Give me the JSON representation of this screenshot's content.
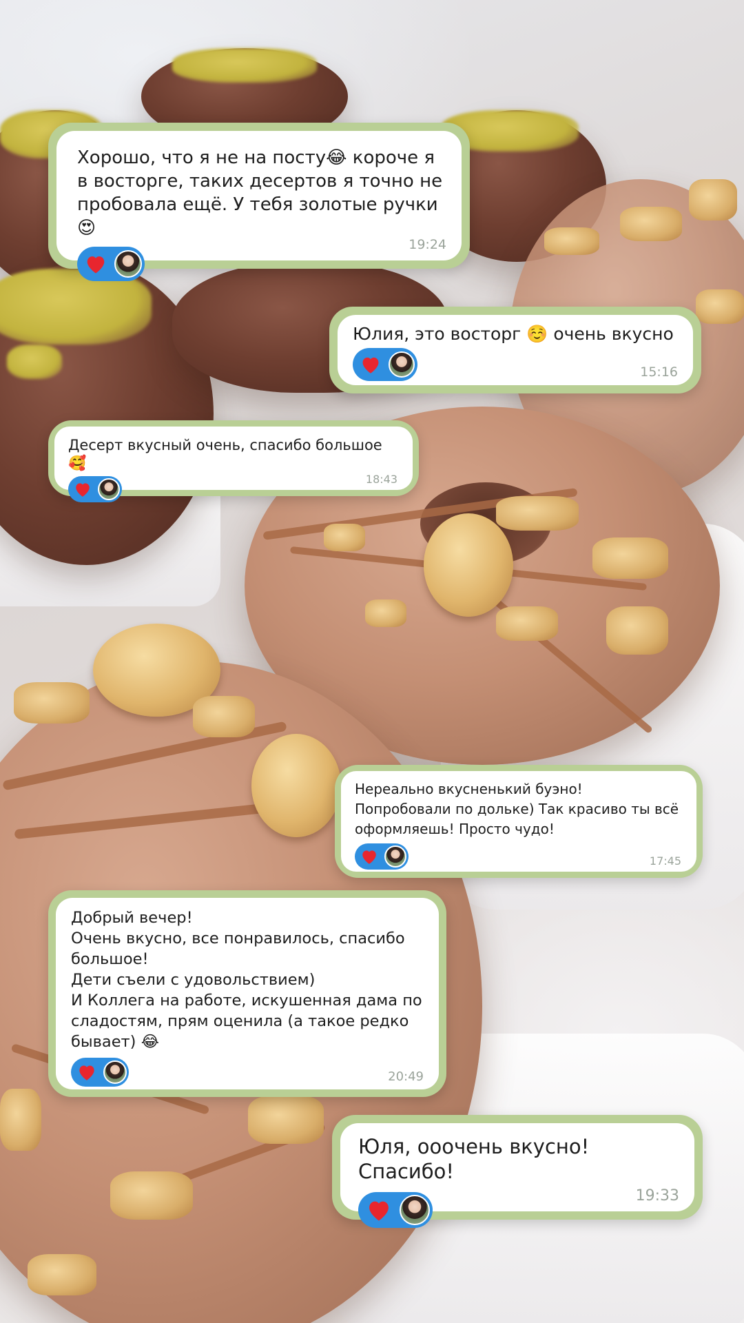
{
  "colors": {
    "bubble_frame": "#b9cf95",
    "bubble_fill": "#ffffff",
    "reaction_pill": "#2f8fe0",
    "heart": "#e8262e",
    "time_text": "#9aa39a",
    "message_text": "#1d1d1d"
  },
  "messages": [
    {
      "text": "Хорошо, что я не на посту😂 короче я\nв восторге, таких десертов я точно не\nпробовала ещё. У тебя золотые ручки😍",
      "time": "19:24",
      "reaction": "heart-icon"
    },
    {
      "text": "Юлия, это восторг ☺️ очень вкусно",
      "time": "15:16",
      "reaction": "heart-icon"
    },
    {
      "text": "Десерт вкусный очень, спасибо большое 🥰",
      "time": "18:43",
      "reaction": "heart-icon"
    },
    {
      "text": "Нереально вкусненький буэно!\nПопробовали по дольке) Так красиво ты всё\nоформляешь! Просто чудо!",
      "time": "17:45",
      "reaction": "heart-icon"
    },
    {
      "text": "Добрый вечер!\nОчень вкусно, все понравилось, спасибо\nбольшое!\nДети съели с удовольствием)\nИ Коллега на работе, искушенная дама по\nсладостям, прям оценила (а такое редко\nбывает) 😂",
      "time": "20:49",
      "reaction": "heart-icon"
    },
    {
      "text": "Юля, ооочень вкусно! Спасибо!",
      "time": "19:33",
      "reaction": "heart-icon"
    }
  ]
}
